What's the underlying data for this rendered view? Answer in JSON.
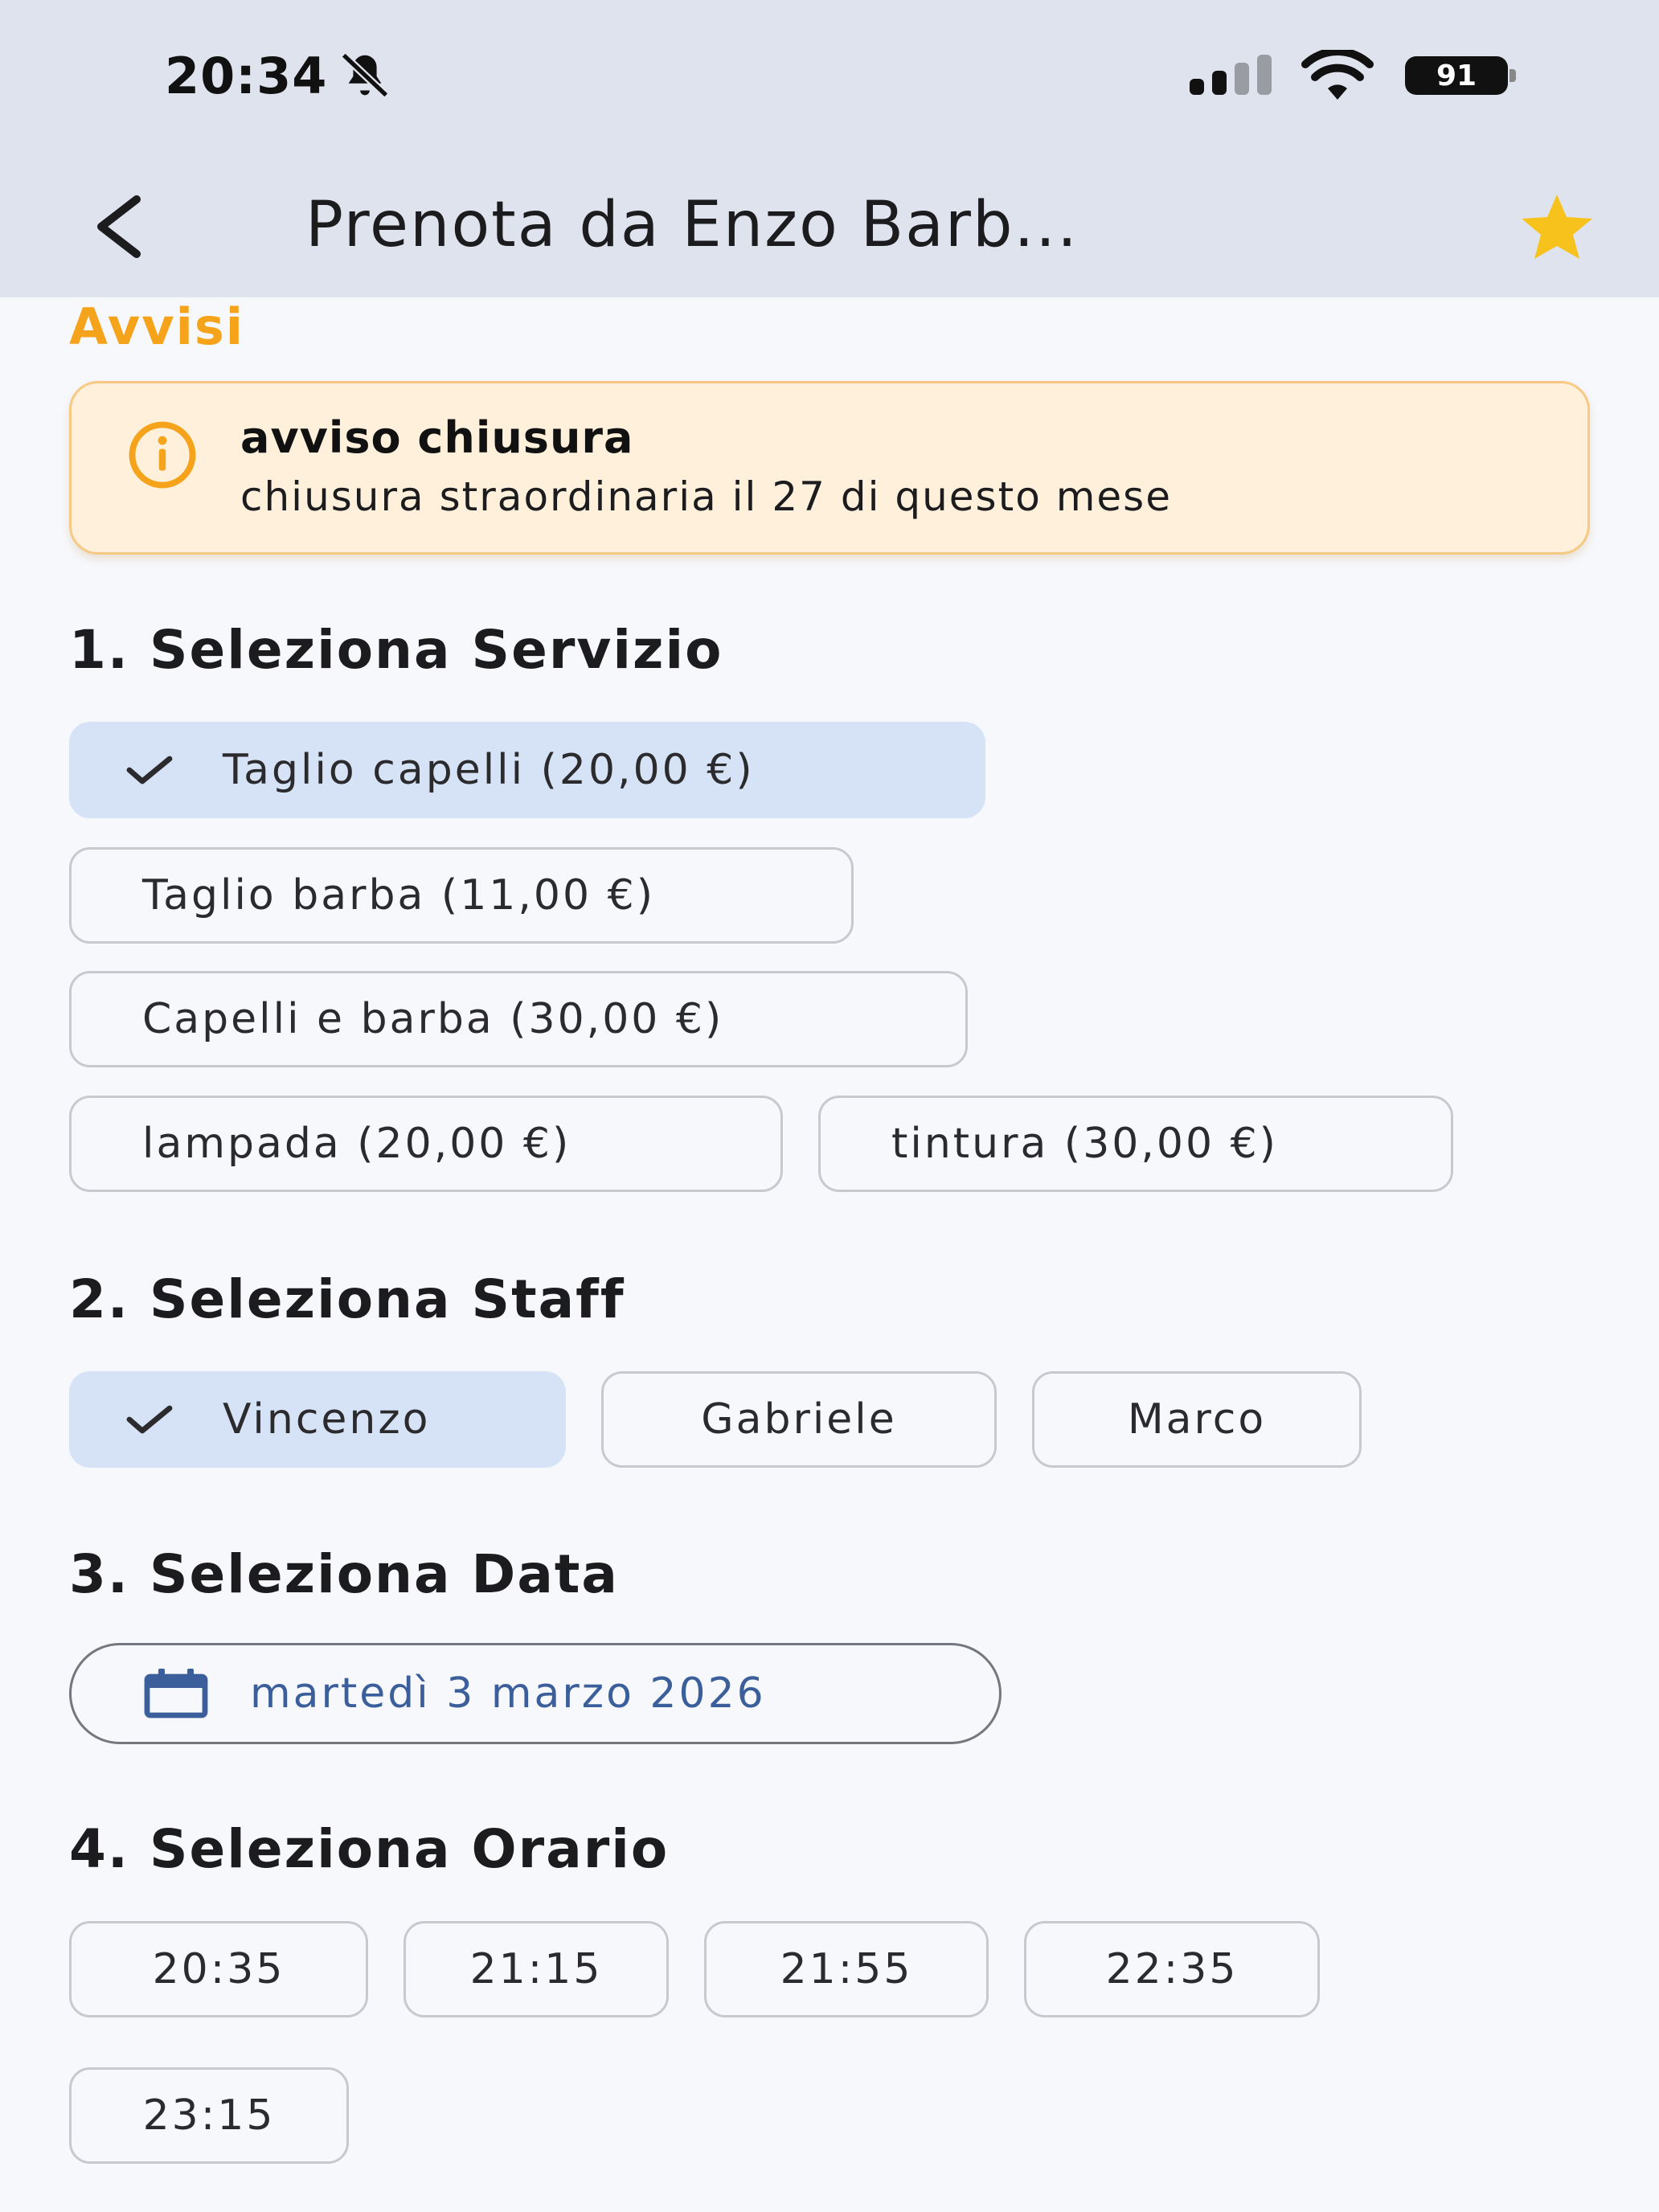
{
  "status_bar": {
    "time": "20:34",
    "battery": "91"
  },
  "header": {
    "title": "Prenota da Enzo Barb..."
  },
  "notices": {
    "heading": "Avvisi",
    "items": [
      {
        "title": "avviso chiusura",
        "text": "chiusura straordinaria il 27 di questo mese"
      }
    ]
  },
  "service": {
    "heading": "1. Seleziona Servizio",
    "options": [
      {
        "label": "Taglio capelli (20,00 €)",
        "selected": true
      },
      {
        "label": "Taglio barba (11,00 €)",
        "selected": false
      },
      {
        "label": "Capelli e barba (30,00 €)",
        "selected": false
      },
      {
        "label": "lampada (20,00 €)",
        "selected": false
      },
      {
        "label": "tintura (30,00 €)",
        "selected": false
      }
    ]
  },
  "staff": {
    "heading": "2. Seleziona Staff",
    "options": [
      {
        "label": "Vincenzo",
        "selected": true
      },
      {
        "label": "Gabriele",
        "selected": false
      },
      {
        "label": "Marco",
        "selected": false
      }
    ]
  },
  "date": {
    "heading": "3. Seleziona Data",
    "value": "martedì 3 marzo 2026"
  },
  "time": {
    "heading": "4. Seleziona Orario",
    "slots": [
      "20:35",
      "21:15",
      "21:55",
      "22:35",
      "23:15"
    ]
  },
  "colors": {
    "accent_orange": "#f5a31a",
    "selected_chip": "#d6e3f7",
    "date_text": "#3b5f9a",
    "alert_bg": "#fff0dc",
    "star": "#f7c21b"
  },
  "icons": [
    "bell-off-icon",
    "signal-icon",
    "wifi-icon",
    "battery-icon",
    "back-arrow-icon",
    "star-icon",
    "info-icon",
    "check-icon",
    "calendar-icon"
  ]
}
